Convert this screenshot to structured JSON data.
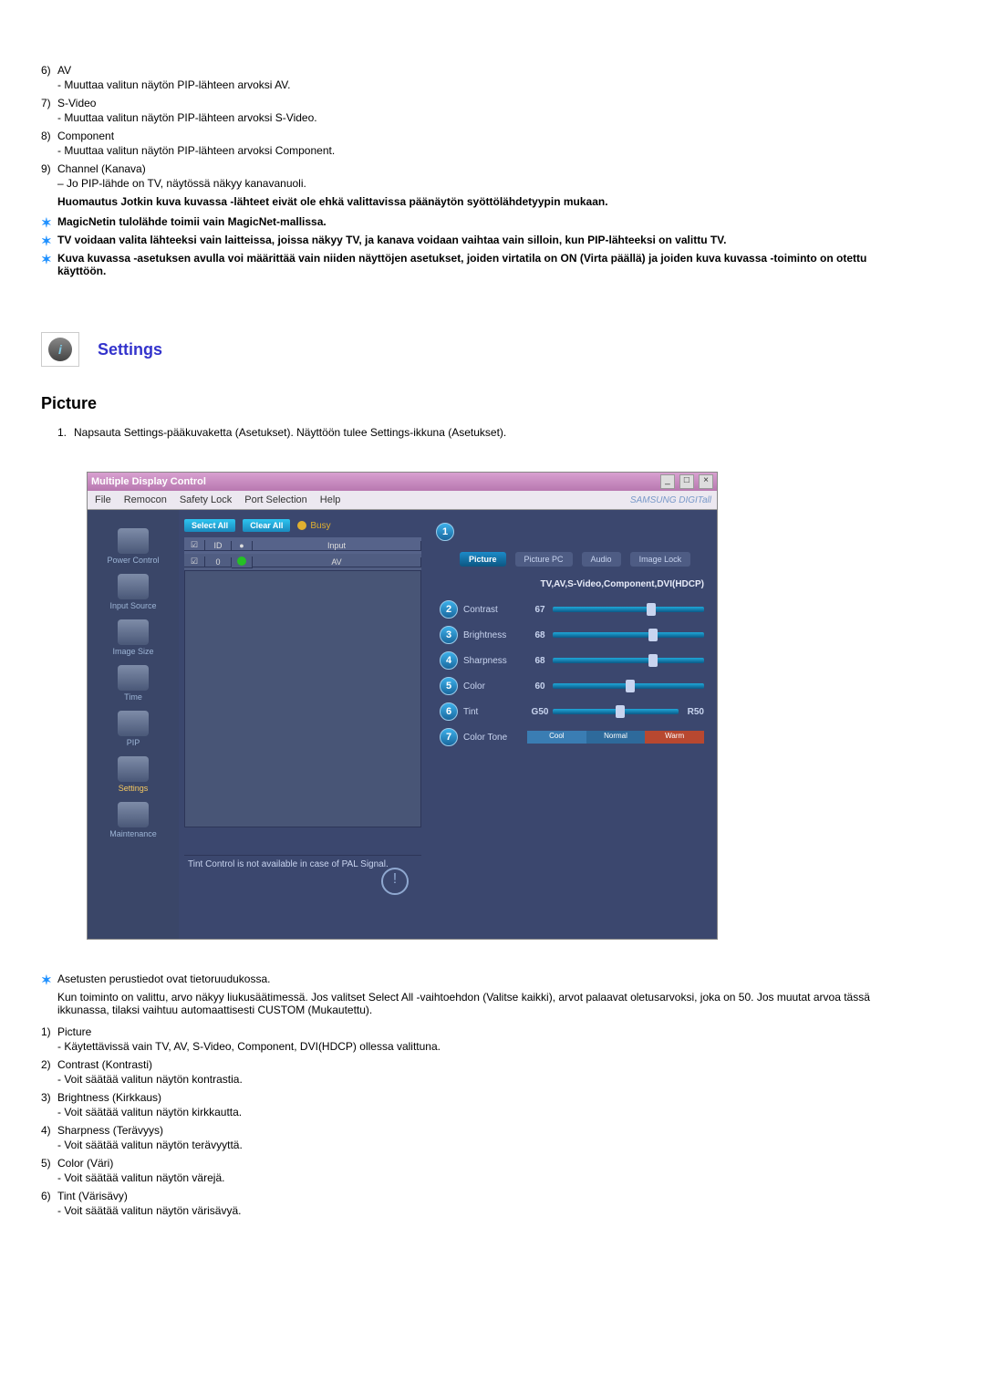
{
  "top_list": [
    {
      "num": "6)",
      "label": "AV",
      "sub": "- Muuttaa valitun näytön PIP-lähteen arvoksi AV."
    },
    {
      "num": "7)",
      "label": "S-Video",
      "sub": "- Muuttaa valitun näytön PIP-lähteen arvoksi S-Video."
    },
    {
      "num": "8)",
      "label": "Component",
      "sub": "- Muuttaa valitun näytön PIP-lähteen arvoksi Component."
    },
    {
      "num": "9)",
      "label": "Channel (Kanava)",
      "sub": "– Jo PIP-lähde on TV, näytössä näkyy kanavanuoli."
    }
  ],
  "bold_note": "Huomautus Jotkin kuva kuvassa -lähteet eivät ole ehkä valittavissa päänäytön syöttölähdetyypin mukaan.",
  "stars": [
    "MagicNetin tulolähde toimii vain MagicNet-mallissa.",
    "TV voidaan valita lähteeksi vain laitteissa, joissa näkyy TV, ja kanava voidaan vaihtaa vain silloin, kun PIP-lähteeksi on valittu TV.",
    "Kuva kuvassa -asetuksen avulla voi määrittää vain niiden näyttöjen asetukset, joiden virtatila on ON (Virta päällä) ja joiden kuva kuvassa -toiminto on otettu käyttöön."
  ],
  "settings_header": "Settings",
  "picture_header": "Picture",
  "picture_step_num": "1.",
  "picture_step": "Napsauta Settings-pääkuvaketta (Asetukset). Näyttöön tulee Settings-ikkuna (Asetukset).",
  "shot": {
    "title": "Multiple Display Control",
    "menu": [
      "File",
      "Remocon",
      "Safety Lock",
      "Port Selection",
      "Help"
    ],
    "brand": "SAMSUNG DIGITall",
    "sidebar": [
      "Power Control",
      "Input Source",
      "Image Size",
      "Time",
      "PIP",
      "Settings",
      "Maintenance"
    ],
    "select_all": "Select All",
    "clear_all": "Clear All",
    "busy": "Busy",
    "cols": {
      "id": "ID",
      "input": "Input"
    },
    "row0": {
      "id": "0",
      "input": "AV"
    },
    "tabs": [
      "Picture",
      "Picture PC",
      "Audio",
      "Image Lock"
    ],
    "src_line": "TV,AV,S-Video,Component,DVI(HDCP)",
    "sliders": [
      {
        "n": "2",
        "label": "Contrast",
        "val": "67",
        "pos": "62%"
      },
      {
        "n": "3",
        "label": "Brightness",
        "val": "68",
        "pos": "63%"
      },
      {
        "n": "4",
        "label": "Sharpness",
        "val": "68",
        "pos": "63%"
      },
      {
        "n": "5",
        "label": "Color",
        "val": "60",
        "pos": "48%"
      },
      {
        "n": "6",
        "label": "Tint",
        "val": "G50",
        "pos": "50%",
        "rval": "R50"
      }
    ],
    "tone_num": "7",
    "tone_label": "Color Tone",
    "tone_cool": "Cool",
    "tone_normal": "Normal",
    "tone_warm": "Warm",
    "tip": "Tint Control is not available in case of PAL Signal.",
    "circle1": "1"
  },
  "star_below": "Asetusten perustiedot ovat tietoruudukossa.",
  "para_below": "Kun toiminto on valittu, arvo näkyy liukusäätimessä. Jos valitset Select All -vaihtoehdon (Valitse kaikki), arvot palaavat oletusarvoksi, joka on 50. Jos muutat arvoa tässä ikkunassa, tilaksi vaihtuu automaattisesti CUSTOM (Mukautettu).",
  "bottom_list": [
    {
      "num": "1)",
      "label": "Picture",
      "sub": "- Käytettävissä vain TV, AV, S-Video, Component, DVI(HDCP) ollessa valittuna."
    },
    {
      "num": "2)",
      "label": "Contrast (Kontrasti)",
      "sub": "- Voit säätää valitun näytön kontrastia."
    },
    {
      "num": "3)",
      "label": "Brightness (Kirkkaus)",
      "sub": "- Voit säätää valitun näytön kirkkautta."
    },
    {
      "num": "4)",
      "label": "Sharpness (Terävyys)",
      "sub": "- Voit säätää valitun näytön terävyyttä."
    },
    {
      "num": "5)",
      "label": "Color (Väri)",
      "sub": "- Voit säätää valitun näytön värejä."
    },
    {
      "num": "6)",
      "label": "Tint (Värisävy)",
      "sub": "- Voit säätää valitun näytön värisävyä."
    }
  ]
}
